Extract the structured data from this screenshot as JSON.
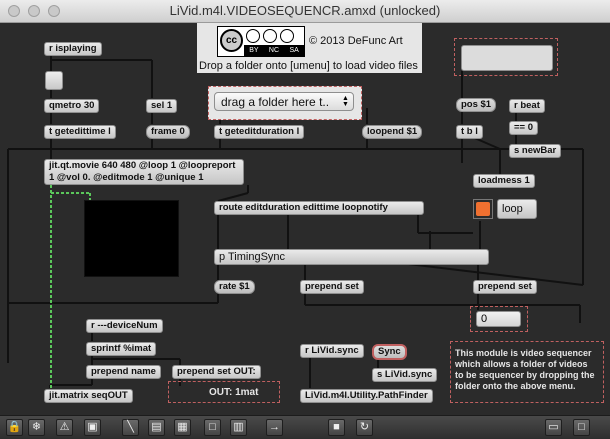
{
  "window": {
    "title": "LiVid.m4l.VIDEOSEQUENCR.amxd (unlocked)"
  },
  "license": {
    "badge_cc": "cc",
    "badge_by": "BY",
    "badge_nc": "NC",
    "badge_sa": "SA",
    "copyright": "© 2013 DeFunc Art"
  },
  "instruction": "Drop a folder onto [umenu] to load video files",
  "umenu": {
    "value": "drag a folder here t..",
    "arrow": "▲▼"
  },
  "objects": {
    "r_isplaying": "r isplaying",
    "qmetro": "qmetro 30",
    "sel1": "sel 1",
    "frame0": "frame 0",
    "t_getedittime": "t getedittime l",
    "t_geteditduration": "t geteditduration l",
    "loopend": "loopend $1",
    "pos": "pos $1",
    "t_bl": "t b l",
    "r_beat": "r beat",
    "eq0": "== 0",
    "s_newbar": "s newBar",
    "jit_movie_line1": "jit.qt.movie 640 480 @loop 1 @loopreport",
    "jit_movie_line2": "1 @vol 0. @editmode 1 @unique 1",
    "loadmess": "loadmess 1",
    "loop_label": "loop",
    "route": "route editduration edittime loopnotify",
    "timingsync": "p TimingSync",
    "rate": "rate $1",
    "prepend_set1": "prepend set",
    "prepend_set2": "prepend set",
    "number_value": "0",
    "r_devicenum": "r ---deviceNum",
    "sprintf": "sprintf %imat",
    "prepend_name": "prepend name",
    "prepend_set_out": "prepend set OUT:",
    "out_msg": "OUT: 1mat",
    "jit_matrix": "jit.matrix seqOUT",
    "r_livid_sync": "r LiVid.sync",
    "sync_msg": "Sync",
    "s_livid_sync": "s LiVid.sync",
    "pathfinder": "LiVid.m4l.Utility.PathFinder"
  },
  "comment": "This module is video sequencer which allows a folder of videos to be sequencer by dropping the folder onto the above menu.",
  "colors": {
    "patch_bg": "#2b2b2b",
    "cord": "#111111",
    "video_cord": "#5bc85b",
    "toggle": "#f07030",
    "panel": "#e6e6e6",
    "presentation_border": "#c06060"
  },
  "toolbar_icons": [
    "lock-icon",
    "snowflake-icon",
    "warning-icon",
    "new-object-icon",
    "patch-cords-icon",
    "inspector-icon",
    "grid-icon",
    "presentation-icon",
    "align-icon",
    "debug-icon",
    "refresh-icon",
    "split-view-icon",
    "fullscreen-icon"
  ]
}
